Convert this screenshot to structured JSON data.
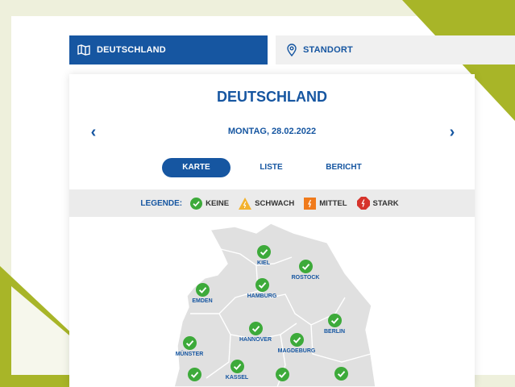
{
  "tabs": {
    "deutschland": "DEUTSCHLAND",
    "standort": "STANDORT"
  },
  "card": {
    "title": "DEUTSCHLAND",
    "date": "MONTAG, 28.02.2022",
    "prev_icon": "chevron-left-icon",
    "next_icon": "chevron-right-icon"
  },
  "views": {
    "karte": "KARTE",
    "liste": "LISTE",
    "bericht": "BERICHT",
    "active": "KARTE"
  },
  "legend": {
    "label": "LEGENDE:",
    "items": [
      {
        "label": "KEINE",
        "icon": "check-circle-icon",
        "color": "#3daa3a"
      },
      {
        "label": "SCHWACH",
        "icon": "warning-triangle-icon",
        "color": "#f3b22d"
      },
      {
        "label": "MITTEL",
        "icon": "warning-square-icon",
        "color": "#f07a1b"
      },
      {
        "label": "STARK",
        "icon": "warning-hexagon-icon",
        "color": "#d6332b"
      }
    ]
  },
  "cities": [
    {
      "name": "KIEL",
      "status": "KEINE"
    },
    {
      "name": "ROSTOCK",
      "status": "KEINE"
    },
    {
      "name": "EMDEN",
      "status": "KEINE"
    },
    {
      "name": "HAMBURG",
      "status": "KEINE"
    },
    {
      "name": "BERLIN",
      "status": "KEINE"
    },
    {
      "name": "HANNOVER",
      "status": "KEINE"
    },
    {
      "name": "MAGDEBURG",
      "status": "KEINE"
    },
    {
      "name": "MÜNSTER",
      "status": "KEINE"
    },
    {
      "name": "KASSEL",
      "status": "KEINE"
    },
    {
      "name": "",
      "status": "KEINE"
    },
    {
      "name": "",
      "status": "KEINE"
    },
    {
      "name": "",
      "status": "KEINE"
    }
  ],
  "colors": {
    "primary": "#1656a1",
    "accent": "#a8b528",
    "ok": "#3daa3a"
  }
}
